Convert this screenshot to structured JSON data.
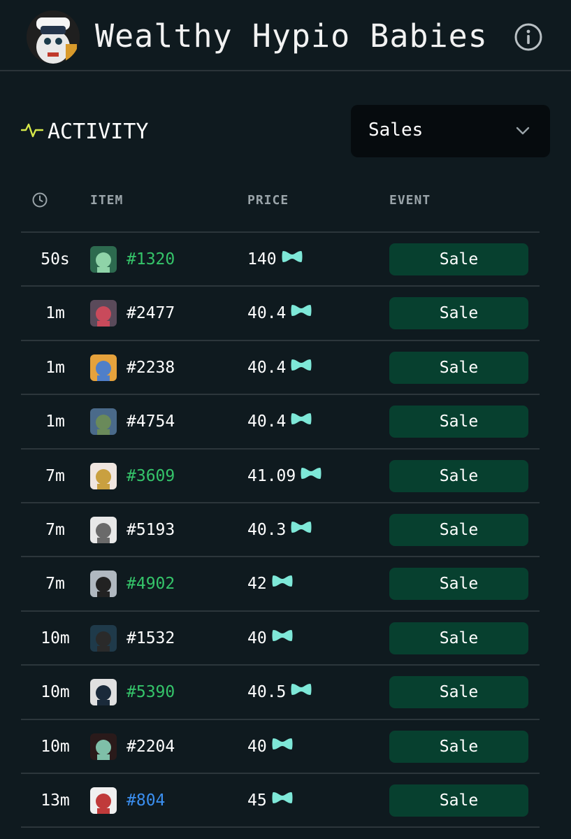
{
  "header": {
    "title": "Wealthy Hypio Babies",
    "avatar_icon": "collection-avatar-icon",
    "info_icon": "info-icon"
  },
  "activity": {
    "label": "ACTIVITY",
    "icon": "activity-pulse-icon",
    "filter": {
      "selected": "Sales",
      "icon": "chevron-down-icon"
    }
  },
  "table": {
    "headers": {
      "time_icon": "clock-icon",
      "item": "ITEM",
      "price": "PRICE",
      "event": "EVENT"
    },
    "currency_icon": "hype-token-icon",
    "rows": [
      {
        "time": "50s",
        "item": "#1320",
        "item_color": "#35c46a",
        "price": "140",
        "event": "Sale",
        "thumb": [
          "#2d6a4f",
          "#8fd3a8"
        ]
      },
      {
        "time": "1m",
        "item": "#2477",
        "item_color": "#ffffff",
        "price": "40.4",
        "event": "Sale",
        "thumb": [
          "#5a4a5a",
          "#c94a5b"
        ]
      },
      {
        "time": "1m",
        "item": "#2238",
        "item_color": "#ffffff",
        "price": "40.4",
        "event": "Sale",
        "thumb": [
          "#e6a23c",
          "#4f7fc9"
        ]
      },
      {
        "time": "1m",
        "item": "#4754",
        "item_color": "#ffffff",
        "price": "40.4",
        "event": "Sale",
        "thumb": [
          "#4a6a8a",
          "#6a8a5a"
        ]
      },
      {
        "time": "7m",
        "item": "#3609",
        "item_color": "#35c46a",
        "price": "41.09",
        "event": "Sale",
        "thumb": [
          "#f0e6e0",
          "#c9a040"
        ]
      },
      {
        "time": "7m",
        "item": "#5193",
        "item_color": "#ffffff",
        "price": "40.3",
        "event": "Sale",
        "thumb": [
          "#e8e8e8",
          "#6a6a6a"
        ]
      },
      {
        "time": "7m",
        "item": "#4902",
        "item_color": "#35c46a",
        "price": "42",
        "event": "Sale",
        "thumb": [
          "#b0b8c0",
          "#222222"
        ]
      },
      {
        "time": "10m",
        "item": "#1532",
        "item_color": "#ffffff",
        "price": "40",
        "event": "Sale",
        "thumb": [
          "#1f3a4a",
          "#2a2a2a"
        ]
      },
      {
        "time": "10m",
        "item": "#5390",
        "item_color": "#35c46a",
        "price": "40.5",
        "event": "Sale",
        "thumb": [
          "#e0e0e0",
          "#1a2a3a"
        ]
      },
      {
        "time": "10m",
        "item": "#2204",
        "item_color": "#ffffff",
        "price": "40",
        "event": "Sale",
        "thumb": [
          "#2a1a1a",
          "#7fbfa8"
        ]
      },
      {
        "time": "13m",
        "item": "#804",
        "item_color": "#3b8ff0",
        "price": "45",
        "event": "Sale",
        "thumb": [
          "#f0f0f0",
          "#c03a3a"
        ]
      }
    ]
  },
  "colors": {
    "background": "#0f1a1f",
    "accent_green": "#35c46a",
    "sale_badge": "#07402f",
    "token": "#7ee8d8",
    "activity_icon": "#d6e84a"
  }
}
